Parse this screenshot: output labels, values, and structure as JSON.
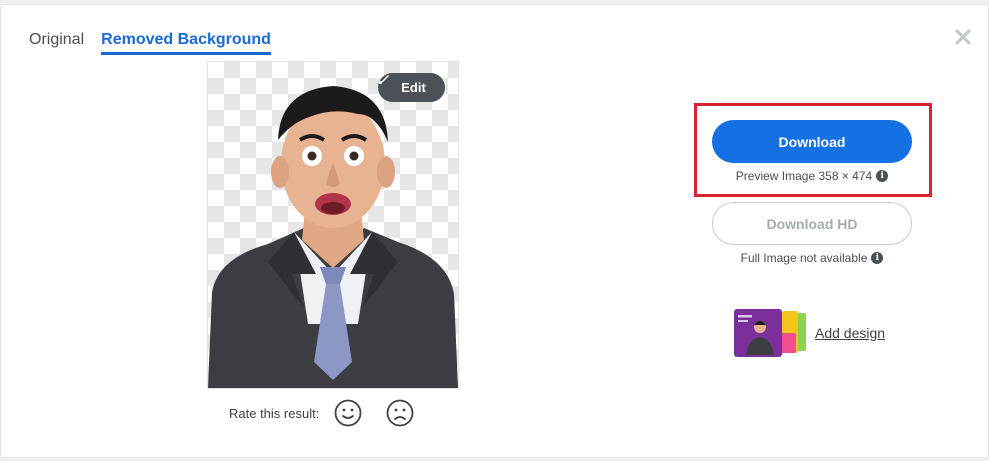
{
  "tabs": [
    {
      "label": "Original",
      "active": false
    },
    {
      "label": "Removed Background",
      "active": true
    }
  ],
  "close_icon": "close-icon",
  "edit_button": {
    "label": "Edit",
    "icon": "brush-icon"
  },
  "rating": {
    "label": "Rate this result:",
    "icons": [
      "smile-icon",
      "frown-icon"
    ]
  },
  "download": {
    "label": "Download",
    "info": "Preview Image 358 × 474",
    "info_icon": "info-icon"
  },
  "download_hd": {
    "label": "Download HD",
    "info": "Full Image not available",
    "info_icon": "info-icon"
  },
  "add_design": {
    "label": "Add design"
  },
  "colors": {
    "accent": "#1570e4",
    "highlight": "#d9232e",
    "tab_active": "#1b6ad2"
  }
}
